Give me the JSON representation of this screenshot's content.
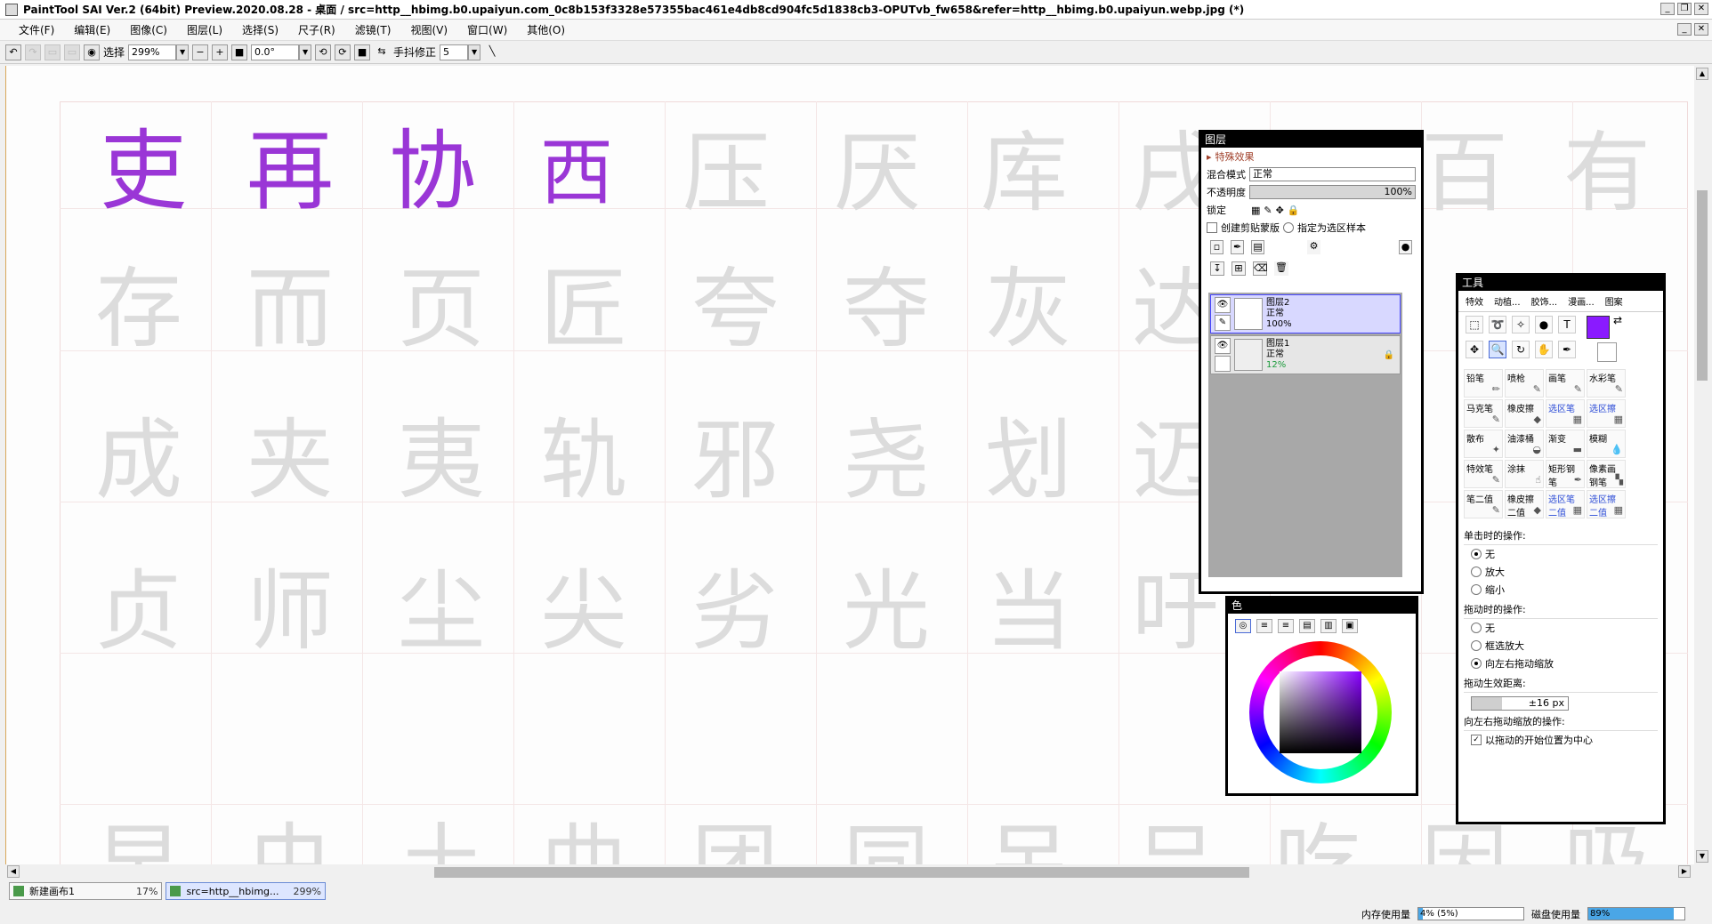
{
  "window": {
    "title": "PaintTool SAI Ver.2 (64bit) Preview.2020.08.28 - 桌面 / src=http__hbimg.b0.upaiyun.com_0c8b153f3328e57355bac461e4db8cd904fc5d1838cb3-OPUTvb_fw658&refer=http__hbimg.b0.upaiyun.webp.jpg (*)"
  },
  "menu": [
    "文件(F)",
    "编辑(E)",
    "图像(C)",
    "图层(L)",
    "选择(S)",
    "尺子(R)",
    "滤镜(T)",
    "视图(V)",
    "窗口(W)",
    "其他(O)"
  ],
  "toolbar": {
    "select_label": "选择",
    "zoom": "299%",
    "rotation": "0.0°",
    "stabilizer_label": "手抖修正",
    "stabilizer_value": "5"
  },
  "canvas": {
    "row1_ink": [
      "吏",
      "再",
      "协",
      "西"
    ],
    "row1_trace": [
      "压",
      "厌",
      "库",
      "戌",
      "百",
      "有"
    ],
    "row2": [
      "存",
      "而",
      "页",
      "匠",
      "夸",
      "夺",
      "灰",
      "达"
    ],
    "row3": [
      "成",
      "夹",
      "夷",
      "轨",
      "邪",
      "尧",
      "划",
      "迈"
    ],
    "row4": [
      "贞",
      "师",
      "尘",
      "尖",
      "劣",
      "光",
      "当",
      "吁"
    ],
    "row5": [
      "早",
      "虫",
      "土",
      "曲",
      "团",
      "同",
      "吊",
      "吕",
      "吃",
      "因",
      "吸"
    ],
    "ink_color": "#9a36d6"
  },
  "tabs": [
    {
      "name": "新建画布1",
      "zoom": "17%"
    },
    {
      "name": "src=http__hbimg...",
      "zoom": "299%"
    }
  ],
  "status": {
    "memory_label": "内存使用量",
    "memory_value": "4% (5%)",
    "memory_fraction": 0.04,
    "disk_label": "磁盘使用量",
    "disk_value": "89%",
    "disk_fraction": 0.89
  },
  "layers_panel": {
    "title": "图层",
    "effects": "特殊效果",
    "blend_label": "混合模式",
    "blend_value": "正常",
    "opacity_label": "不透明度",
    "opacity_value": "100%",
    "lock_label": "锁定",
    "clip_label": "创建剪贴蒙版",
    "sample_label": "指定为选区样本",
    "layers": [
      {
        "name": "图层2",
        "mode": "正常",
        "opacity": "100%"
      },
      {
        "name": "图层1",
        "mode": "正常",
        "opacity": "12%"
      }
    ]
  },
  "color_panel": {
    "title": "色",
    "current_color": "#8a1aff"
  },
  "tools_panel": {
    "title": "工具",
    "tabs": [
      "特效",
      "动植...",
      "胶饰...",
      "漫画...",
      "图案"
    ],
    "brushes": [
      {
        "label": "铅笔",
        "blue": false
      },
      {
        "label": "喷枪",
        "blue": false
      },
      {
        "label": "画笔",
        "blue": false
      },
      {
        "label": "水彩笔",
        "blue": false
      },
      {
        "label": "马克笔",
        "blue": false
      },
      {
        "label": "橡皮擦",
        "blue": false
      },
      {
        "label": "选区笔",
        "blue": true
      },
      {
        "label": "选区擦",
        "blue": true
      },
      {
        "label": "散布",
        "blue": false
      },
      {
        "label": "油漆桶",
        "blue": false
      },
      {
        "label": "渐变",
        "blue": false
      },
      {
        "label": "模糊",
        "blue": false
      },
      {
        "label": "特效笔",
        "blue": false
      },
      {
        "label": "涂抹",
        "blue": false
      },
      {
        "label": "矩形钢笔",
        "blue": false
      },
      {
        "label": "像素画钢笔",
        "blue": false
      },
      {
        "label": "笔二值",
        "blue": false
      },
      {
        "label": "橡皮擦二值",
        "blue": false
      },
      {
        "label": "选区笔二值",
        "blue": true
      },
      {
        "label": "选区擦二值",
        "blue": true
      }
    ],
    "click_label": "单击时的操作:",
    "click_options": [
      "无",
      "放大",
      "缩小"
    ],
    "drag_label": "拖动时的操作:",
    "drag_options": [
      "无",
      "框选放大",
      "向左右拖动缩放"
    ],
    "distance_label": "拖动生效距离:",
    "distance_value": "±16 px",
    "lr_label": "向左右拖动缩放的操作:",
    "center_label": "以拖动的开始位置为中心"
  }
}
